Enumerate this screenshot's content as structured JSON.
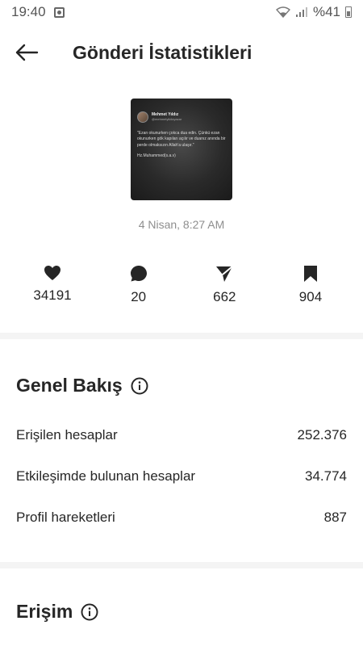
{
  "status_bar": {
    "time": "19:40",
    "battery": "%41"
  },
  "header": {
    "title": "Gönderi İstatistikleri"
  },
  "post": {
    "thumbnail": {
      "author_name": "Mehmet Yıldız",
      "author_handle": "@mehmetyildizyazar",
      "quote": "\"Ezan okunurken çokca dua edin. Çünkü ezan okunurken gök kapıları açılır ve duanız anında bir perde olmaksızın Allah'a ulaşır.\"",
      "attribution": "Hz.Muhammed(s.a.v)"
    },
    "date": "4 Nisan, 8:27 AM"
  },
  "stats": [
    {
      "icon": "heart-icon",
      "value": "34191"
    },
    {
      "icon": "comment-icon",
      "value": "20"
    },
    {
      "icon": "share-icon",
      "value": "662"
    },
    {
      "icon": "bookmark-icon",
      "value": "904"
    }
  ],
  "overview": {
    "title": "Genel Bakış",
    "rows": [
      {
        "label": "Erişilen hesaplar",
        "value": "252.376"
      },
      {
        "label": "Etkileşimde bulunan hesaplar",
        "value": "34.774"
      },
      {
        "label": "Profil hareketleri",
        "value": "887"
      }
    ]
  },
  "reach": {
    "title": "Erişim"
  },
  "colors": {
    "text": "#262626",
    "muted": "#8e8e8e",
    "divider": "#f4f4f4"
  }
}
